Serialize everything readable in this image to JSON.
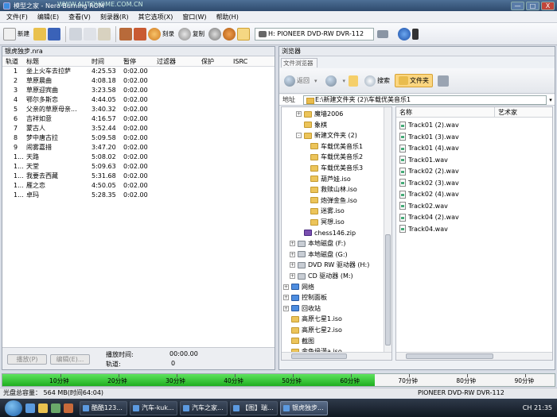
{
  "window": {
    "title": "模型之家 - Nero Burning ROM",
    "title_watermark": "WWW.AUTOHOME.COM.CN"
  },
  "window_controls": {
    "minimize": "—",
    "maximize": "□",
    "close": "X"
  },
  "menu": [
    "文件(F)",
    "编辑(E)",
    "查看(V)",
    "刻录器(R)",
    "其它选项(X)",
    "窗口(W)",
    "帮助(H)"
  ],
  "toolbar": {
    "new_label": "新建",
    "burn_label": "刻录",
    "copy_label": "复制",
    "drive": "H: PIONEER DVD-RW  DVR-112"
  },
  "compilation": {
    "title": "银虎独步.nra",
    "columns": [
      "轨道",
      "标题",
      "时间",
      "暂停",
      "过滤器",
      "保护",
      "ISRC"
    ],
    "tracks": [
      {
        "no": "1",
        "title": "坐上火车去拉萨",
        "time": "4:25.53",
        "pause": "0:02.00"
      },
      {
        "no": "2",
        "title": "草原晨曲",
        "time": "4:08.18",
        "pause": "0:02.00"
      },
      {
        "no": "3",
        "title": "草原迎宾曲",
        "time": "3:23.58",
        "pause": "0:02.00"
      },
      {
        "no": "4",
        "title": "鄂尔多斯恋",
        "time": "4:44.05",
        "pause": "0:02.00"
      },
      {
        "no": "5",
        "title": "父亲的草原母亲...",
        "time": "3:40.32",
        "pause": "0:02.00"
      },
      {
        "no": "6",
        "title": "吉祥如意",
        "time": "4:16.57",
        "pause": "0:02.00"
      },
      {
        "no": "7",
        "title": "蒙古人",
        "time": "3:52.44",
        "pause": "0:02.00"
      },
      {
        "no": "8",
        "title": "梦中唐古拉",
        "time": "5:09.58",
        "pause": "0:02.00"
      },
      {
        "no": "9",
        "title": "闹雾嘉措",
        "time": "3:47.20",
        "pause": "0:02.00"
      },
      {
        "no": "1...",
        "title": "天路",
        "time": "5:08.02",
        "pause": "0:02.00"
      },
      {
        "no": "1...",
        "title": "天堂",
        "time": "5:09.63",
        "pause": "0:02.00"
      },
      {
        "no": "1...",
        "title": "我要去西藏",
        "time": "5:31.68",
        "pause": "0:02.00"
      },
      {
        "no": "1...",
        "title": "雁之恋",
        "time": "4:50.05",
        "pause": "0:02.00"
      },
      {
        "no": "1...",
        "title": "卓玛",
        "time": "5:28.35",
        "pause": "0:02.00"
      }
    ],
    "play_btn": "播放(P)",
    "edit_btn": "编辑(E)...",
    "play_time_label": "播放时间:",
    "play_time_value": "00:00.00",
    "track_label": "轨道:",
    "track_value": "0"
  },
  "browser": {
    "title": "浏览器",
    "tab": "文件浏览器",
    "back": "返回",
    "search": "搜索",
    "folders": "文件夹",
    "address_label": "地址",
    "address": "E:\\新建文件夹 (2)\\车载优美音乐1",
    "tree": [
      {
        "label": "魔墙2006",
        "level": 3,
        "icon": "folder",
        "exp": "+"
      },
      {
        "label": "象棋",
        "level": 3,
        "icon": "folder",
        "exp": ""
      },
      {
        "label": "新建文件夹 (2)",
        "level": 3,
        "icon": "folder",
        "exp": "-"
      },
      {
        "label": "车载优美音乐1",
        "level": 4,
        "icon": "folder",
        "exp": ""
      },
      {
        "label": "车载优美音乐2",
        "level": 4,
        "icon": "folder",
        "exp": ""
      },
      {
        "label": "车载优美音乐3",
        "level": 4,
        "icon": "folder",
        "exp": ""
      },
      {
        "label": "葫芦娃.iso",
        "level": 4,
        "icon": "folder",
        "exp": ""
      },
      {
        "label": "救赎山林.iso",
        "level": 4,
        "icon": "folder",
        "exp": ""
      },
      {
        "label": "炮弹金鱼.iso",
        "level": 4,
        "icon": "folder",
        "exp": ""
      },
      {
        "label": "迷雾.iso",
        "level": 4,
        "icon": "folder",
        "exp": ""
      },
      {
        "label": "冥想.iso",
        "level": 4,
        "icon": "folder",
        "exp": ""
      },
      {
        "label": "chess146.zip",
        "level": 3,
        "icon": "zip",
        "exp": ""
      },
      {
        "label": "本地磁盘 (F:)",
        "level": 2,
        "icon": "drive",
        "exp": "+"
      },
      {
        "label": "本地磁盘 (G:)",
        "level": 2,
        "icon": "drive",
        "exp": "+"
      },
      {
        "label": "DVD RW 驱动器 (H:)",
        "level": 2,
        "icon": "drive",
        "exp": "+"
      },
      {
        "label": "CD 驱动器 (M:)",
        "level": 2,
        "icon": "drive",
        "exp": "+"
      },
      {
        "label": "网络",
        "level": 1,
        "icon": "net",
        "exp": "+"
      },
      {
        "label": "控制面板",
        "level": 1,
        "icon": "net",
        "exp": "+"
      },
      {
        "label": "回收站",
        "level": 1,
        "icon": "net",
        "exp": "+"
      },
      {
        "label": "高原七星1.iso",
        "level": 1,
        "icon": "folder",
        "exp": ""
      },
      {
        "label": "高原七星2.iso",
        "level": 1,
        "icon": "folder",
        "exp": ""
      },
      {
        "label": "截图",
        "level": 1,
        "icon": "folder",
        "exp": ""
      },
      {
        "label": "金色缘漫a.iso",
        "level": 1,
        "icon": "folder",
        "exp": ""
      },
      {
        "label": "金色缘漫b.iso",
        "level": 1,
        "icon": "folder",
        "exp": ""
      }
    ],
    "file_columns": [
      "名称",
      "艺术家"
    ],
    "files": [
      "Track01 (2).wav",
      "Track01 (3).wav",
      "Track01 (4).wav",
      "Track01.wav",
      "Track02 (2).wav",
      "Track02 (3).wav",
      "Track02 (4).wav",
      "Track02.wav",
      "Track04 (2).wav",
      "Track04.wav"
    ]
  },
  "capacity": {
    "used_minutes": 64.07,
    "max_minutes": 95,
    "ticks": [
      "10分钟",
      "20分钟",
      "30分钟",
      "40分钟",
      "50分钟",
      "60分钟",
      "70分钟",
      "80分钟",
      "90分钟"
    ]
  },
  "status": {
    "total": "光盘总容量：  564 MB(时间64:04)",
    "drive": "PIONEER  DVD-RW  DVR-112"
  },
  "taskbar": {
    "tasks": [
      "酷酷123...",
      "汽车-kuk...",
      "汽车之家...",
      "【图】瑞...",
      "银虎独步..."
    ],
    "active_index": 4,
    "tray": "CH  21:35"
  }
}
